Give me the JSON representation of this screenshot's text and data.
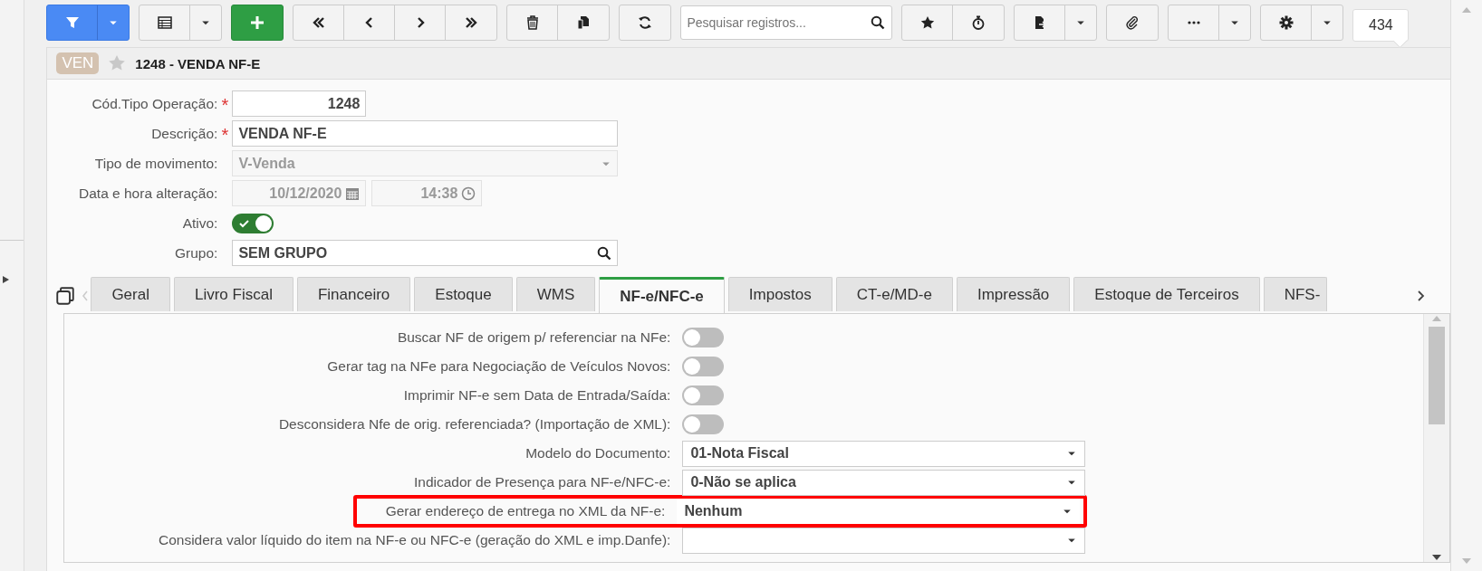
{
  "toolbar": {
    "search": {
      "placeholder": "Pesquisar registros..."
    },
    "count": "434"
  },
  "header": {
    "badge": "VEN",
    "favorite": false,
    "title": "1248 - VENDA NF-E"
  },
  "form": [
    {
      "kind": "number",
      "label": "Cód.Tipo Operação:",
      "required_mark": "*",
      "value": "1248"
    },
    {
      "kind": "text",
      "label": "Descrição:",
      "required_mark": "*",
      "value": "VENDA NF-E"
    },
    {
      "kind": "select",
      "label": "Tipo de movimento:",
      "value": "V-Venda",
      "disabled": true
    },
    {
      "kind": "datetime",
      "label": "Data e hora alteração:",
      "date": "10/12/2020",
      "time": "14:38",
      "disabled": true
    },
    {
      "kind": "toggle",
      "label": "Ativo:",
      "on": true
    },
    {
      "kind": "lookup",
      "label": "Grupo:",
      "value": "SEM GRUPO"
    }
  ],
  "tabs": [
    {
      "label": "Geral",
      "selected": false
    },
    {
      "label": "Livro Fiscal",
      "selected": false
    },
    {
      "label": "Financeiro",
      "selected": false
    },
    {
      "label": "Estoque",
      "selected": false
    },
    {
      "label": "WMS",
      "selected": false
    },
    {
      "label": "NF-e/NFC-e",
      "selected": true
    },
    {
      "label": "Impostos",
      "selected": false
    },
    {
      "label": "CT-e/MD-e",
      "selected": false
    },
    {
      "label": "Impressão",
      "selected": false
    },
    {
      "label": "Estoque de Terceiros",
      "selected": false
    },
    {
      "label": "NFS-",
      "selected": false
    }
  ],
  "panel": [
    {
      "kind": "toggle",
      "label": "Buscar NF de origem p/ referenciar na NFe:",
      "on": false,
      "highlighted": false
    },
    {
      "kind": "toggle",
      "label": "Gerar tag na NFe para Negociação de Veículos Novos:",
      "on": false,
      "highlighted": false
    },
    {
      "kind": "toggle",
      "label": "Imprimir NF-e sem Data de Entrada/Saída:",
      "on": false,
      "highlighted": false
    },
    {
      "kind": "toggle",
      "label": "Desconsidera Nfe de orig. referenciada? (Importação de XML):",
      "on": false,
      "highlighted": false
    },
    {
      "kind": "select",
      "label": "Modelo do Documento:",
      "value": "01-Nota Fiscal",
      "highlighted": false
    },
    {
      "kind": "select",
      "label": "Indicador de Presença para NF-e/NFC-e:",
      "value": "0-Não se aplica",
      "highlighted": false
    },
    {
      "kind": "select",
      "label": "Gerar endereço de entrega no XML da NF-e:",
      "value": "Nenhum",
      "highlighted": true
    },
    {
      "kind": "select",
      "label": "Considera valor líquido do item na NF-e ou NFC-e (geração do XML e imp.Danfe):",
      "highlighted": false
    }
  ]
}
